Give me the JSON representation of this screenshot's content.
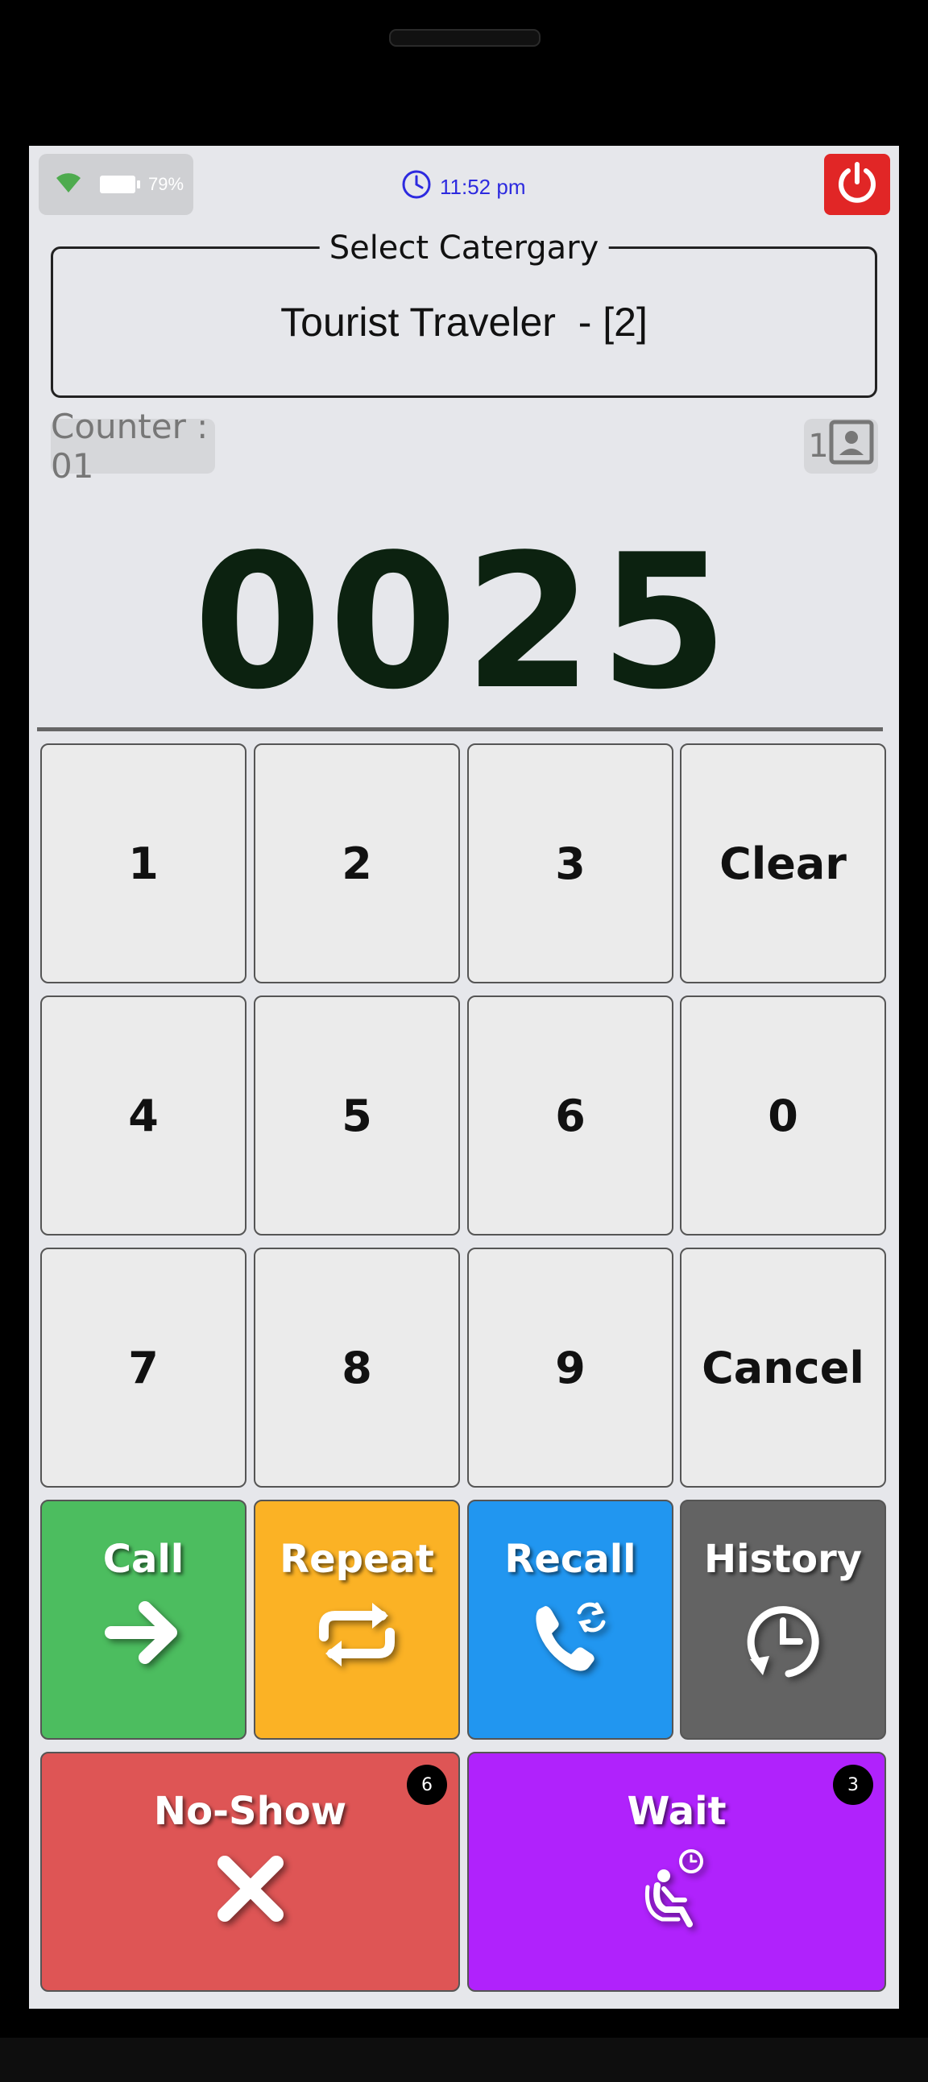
{
  "status_bar": {
    "battery_percent": "79%",
    "time": "11:52 pm"
  },
  "category": {
    "legend": "Select Catergary",
    "value": "Tourist Traveler  - [2]"
  },
  "counter": {
    "label": "Counter : 01"
  },
  "profile": {
    "count": "1"
  },
  "token": {
    "number": "0025"
  },
  "keypad": {
    "k1": "1",
    "k2": "2",
    "k3": "3",
    "clear": "Clear",
    "k4": "4",
    "k5": "5",
    "k6": "6",
    "k0": "0",
    "k7": "7",
    "k8": "8",
    "k9": "9",
    "cancel": "Cancel"
  },
  "actions": {
    "call": "Call",
    "repeat": "Repeat",
    "recall": "Recall",
    "history": "History",
    "noshow": "No-Show",
    "noshow_count": "6",
    "wait": "Wait",
    "wait_count": "3"
  },
  "colors": {
    "call": "#4cbd5f",
    "repeat": "#fbb225",
    "recall": "#2196f0",
    "history": "#636363",
    "noshow": "#de5555",
    "wait": "#b022fc"
  }
}
